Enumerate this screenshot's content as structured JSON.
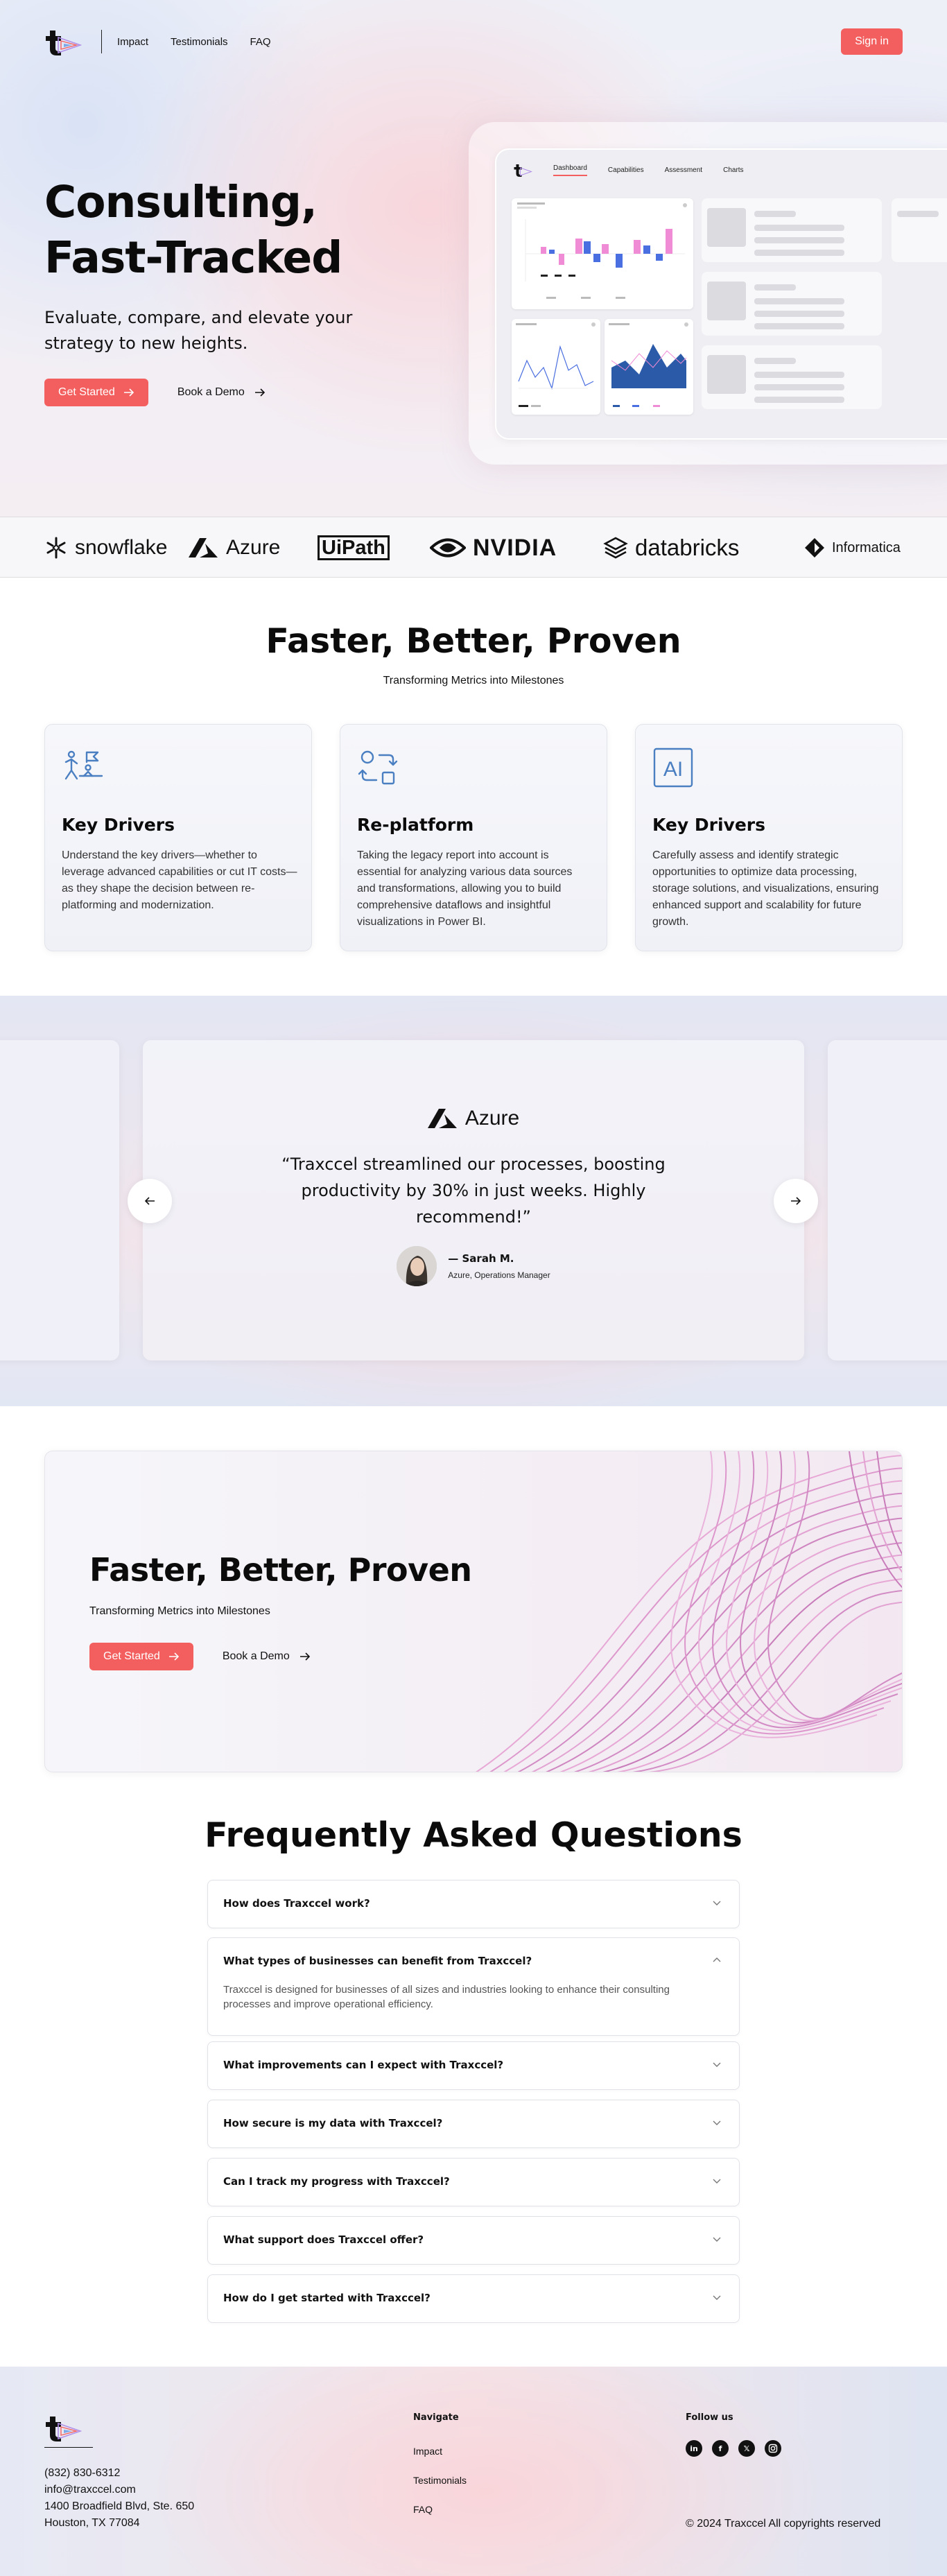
{
  "nav": {
    "links": [
      "Impact",
      "Testimonials",
      "FAQ"
    ],
    "signin_label": "Sign in"
  },
  "hero": {
    "title_line1": "Consulting,",
    "title_line2": "Fast-Tracked",
    "subtitle": "Evaluate, compare, and elevate your strategy to new heights.",
    "primary_cta": "Get Started",
    "secondary_cta": "Book a Demo",
    "mock_tabs": [
      "Dashboard",
      "Capabilities",
      "Assessment",
      "Charts"
    ],
    "mock_active_tab": "Dashboard"
  },
  "logos": [
    "snowflake",
    "Azure",
    "UiPath",
    "NVIDIA",
    "databricks",
    "Informatica"
  ],
  "features": {
    "title": "Faster, Better, Proven",
    "subtitle": "Transforming Metrics into Milestones",
    "cards": [
      {
        "icon": "team-goal-icon",
        "title": "Key Drivers",
        "text": "Understand the key drivers—whether to leverage advanced capabilities or cut IT costs—as they shape the decision between re-platforming and modernization."
      },
      {
        "icon": "replatform-icon",
        "title": "Re-platform",
        "text": "Taking the legacy report into account is essential for analyzing various data sources and transformations, allowing you to build comprehensive dataflows and insightful visualizations in Power BI."
      },
      {
        "icon": "ai-icon",
        "title": "Key Drivers",
        "text": "Carefully assess and identify strategic opportunities to optimize data processing, storage solutions, and visualizations, ensuring enhanced support and scalability for future growth."
      }
    ]
  },
  "testimonial": {
    "brand": "Azure",
    "quote": "“Traxccel streamlined our processes, boosting productivity by 30% in just weeks. Highly recommend!”",
    "name": "— Sarah M.",
    "role": "Azure, Operations Manager"
  },
  "cta_banner": {
    "title": "Faster, Better, Proven",
    "subtitle": "Transforming Metrics into Milestones",
    "primary_cta": "Get Started",
    "secondary_cta": "Book a Demo"
  },
  "faq": {
    "title": "Frequently Asked Questions",
    "items": [
      {
        "q": "How does Traxccel work?",
        "open": false
      },
      {
        "q": "What types of businesses can benefit from Traxccel?",
        "open": true,
        "a": "Traxccel is designed for businesses of all sizes and industries looking to enhance their consulting processes and improve operational efficiency."
      },
      {
        "q": "What improvements can I expect with Traxccel?",
        "open": false
      },
      {
        "q": "How secure is my data with Traxccel?",
        "open": false
      },
      {
        "q": "Can I track my progress with Traxccel?",
        "open": false
      },
      {
        "q": "What support does Traxccel offer?",
        "open": false
      },
      {
        "q": "How do I get started with Traxccel?",
        "open": false
      }
    ]
  },
  "footer": {
    "phone": "(832) 830-6312",
    "email": "info@traxccel.com",
    "address1": "1400 Broadfield Blvd, Ste. 650",
    "address2": "Houston, TX 77084",
    "navigate_title": "Navigate",
    "nav_links": [
      "Impact",
      "Testimonials",
      "FAQ"
    ],
    "follow_title": "Follow us",
    "socials": [
      "linkedin-icon",
      "facebook-icon",
      "x-icon",
      "instagram-icon"
    ],
    "copyright": "© 2024 Traxccel All copyrights reserved"
  },
  "colors": {
    "accent": "#f35e5e",
    "icon_blue": "#4a7fc1",
    "mock_bar_pink": "#f08bd5",
    "mock_bar_blue": "#4a6fe0",
    "mock_area_blue": "#2b5aa8"
  }
}
